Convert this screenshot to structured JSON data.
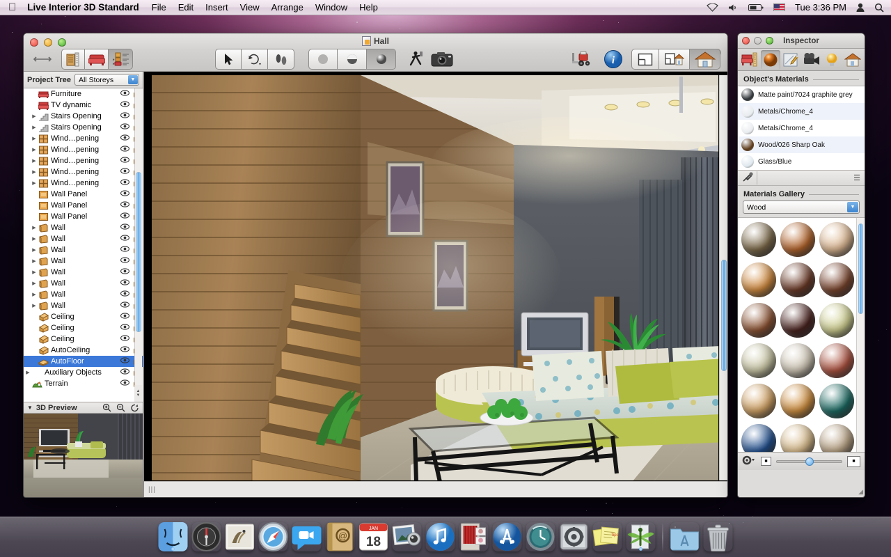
{
  "menubar": {
    "apple_icon": "apple-icon",
    "app_name": "Live Interior 3D Standard",
    "items": [
      "File",
      "Edit",
      "Insert",
      "View",
      "Arrange",
      "Window",
      "Help"
    ],
    "status": {
      "wifi_icon": "wifi-icon",
      "volume_icon": "volume-icon",
      "battery_icon": "battery-icon",
      "flag_icon": "us-flag-icon",
      "clock": "Tue 3:36 PM",
      "user_icon": "user-icon",
      "spotlight_icon": "search-icon"
    }
  },
  "window": {
    "title": "Hall",
    "doc_icon": "document-icon",
    "toolbar": {
      "resize_icon": "resize-horizontal-icon",
      "left_group": [
        {
          "name": "building-tool",
          "icon": "building-icon",
          "active": false
        },
        {
          "name": "furniture-tool",
          "icon": "armchair-icon",
          "active": false
        },
        {
          "name": "list-tool",
          "icon": "object-list-icon",
          "active": true
        }
      ],
      "select_group": [
        {
          "name": "arrow-select-tool",
          "icon": "arrow-cursor-icon",
          "active": false
        },
        {
          "name": "rotate-tool",
          "icon": "rotate-icon",
          "active": false
        },
        {
          "name": "walk-tool",
          "icon": "footprints-icon",
          "active": false
        }
      ],
      "render_group": [
        {
          "name": "flat-render",
          "icon": "flat-sphere-icon",
          "active": false
        },
        {
          "name": "shaded-render",
          "icon": "half-sphere-icon",
          "active": false
        },
        {
          "name": "realistic-render",
          "icon": "glossy-sphere-icon",
          "active": true
        }
      ],
      "walkthrough_icon": "walking-person-icon",
      "camera_icon": "camera-icon",
      "import_icon": "forklift-icon",
      "info_icon": "info-circle-icon",
      "view_group": [
        {
          "name": "plan-view",
          "icon": "floorplan-icon",
          "active": false
        },
        {
          "name": "plan-3d-view",
          "icon": "floorplan-3d-icon",
          "active": false
        },
        {
          "name": "3d-view",
          "icon": "house-icon",
          "active": true
        }
      ],
      "minimize_pill": "toolbar-toggle-pill"
    }
  },
  "project_tree": {
    "header_label": "Project Tree",
    "storey_filter": {
      "value": "All Storeys",
      "arrow_icon": "chevron-down-icon"
    },
    "col_eye_icon": "eye-icon",
    "col_lock_icon": "lock-open-icon",
    "rows": [
      {
        "label": "Furniture",
        "icon": "furniture-icon",
        "twisty": false,
        "indent": 1,
        "selected": false
      },
      {
        "label": "TV dynamic",
        "icon": "armchair-icon",
        "twisty": false,
        "indent": 1,
        "selected": false
      },
      {
        "label": "Stairs Opening",
        "icon": "stairs-icon",
        "twisty": true,
        "indent": 1,
        "selected": false
      },
      {
        "label": "Stairs Opening",
        "icon": "stairs-icon",
        "twisty": true,
        "indent": 1,
        "selected": false
      },
      {
        "label": "Wind…pening",
        "icon": "window-icon",
        "twisty": true,
        "indent": 1,
        "selected": false
      },
      {
        "label": "Wind…pening",
        "icon": "window-icon",
        "twisty": true,
        "indent": 1,
        "selected": false
      },
      {
        "label": "Wind…pening",
        "icon": "window-icon",
        "twisty": true,
        "indent": 1,
        "selected": false
      },
      {
        "label": "Wind…pening",
        "icon": "window-icon",
        "twisty": true,
        "indent": 1,
        "selected": false
      },
      {
        "label": "Wind…pening",
        "icon": "window-icon",
        "twisty": true,
        "indent": 1,
        "selected": false
      },
      {
        "label": "Wall Panel",
        "icon": "wall-panel-icon",
        "twisty": false,
        "indent": 1,
        "selected": false
      },
      {
        "label": "Wall Panel",
        "icon": "wall-panel-icon",
        "twisty": false,
        "indent": 1,
        "selected": false
      },
      {
        "label": "Wall Panel",
        "icon": "wall-panel-icon",
        "twisty": false,
        "indent": 1,
        "selected": false
      },
      {
        "label": "Wall",
        "icon": "wall-icon",
        "twisty": true,
        "indent": 1,
        "selected": false
      },
      {
        "label": "Wall",
        "icon": "wall-icon",
        "twisty": true,
        "indent": 1,
        "selected": false
      },
      {
        "label": "Wall",
        "icon": "wall-icon",
        "twisty": true,
        "indent": 1,
        "selected": false
      },
      {
        "label": "Wall",
        "icon": "wall-icon",
        "twisty": true,
        "indent": 1,
        "selected": false
      },
      {
        "label": "Wall",
        "icon": "wall-icon",
        "twisty": true,
        "indent": 1,
        "selected": false
      },
      {
        "label": "Wall",
        "icon": "wall-icon",
        "twisty": true,
        "indent": 1,
        "selected": false
      },
      {
        "label": "Wall",
        "icon": "wall-icon",
        "twisty": true,
        "indent": 1,
        "selected": false
      },
      {
        "label": "Wall",
        "icon": "wall-icon",
        "twisty": true,
        "indent": 1,
        "selected": false
      },
      {
        "label": "Ceiling",
        "icon": "ceiling-icon",
        "twisty": false,
        "indent": 1,
        "selected": false
      },
      {
        "label": "Ceiling",
        "icon": "ceiling-icon",
        "twisty": false,
        "indent": 1,
        "selected": false
      },
      {
        "label": "Ceiling",
        "icon": "ceiling-icon",
        "twisty": false,
        "indent": 1,
        "selected": false
      },
      {
        "label": "AutoCeiling",
        "icon": "ceiling-icon",
        "twisty": false,
        "indent": 1,
        "selected": false
      },
      {
        "label": "AutoFloor",
        "icon": "floor-icon",
        "twisty": false,
        "indent": 1,
        "selected": true
      },
      {
        "label": "Auxiliary Objects",
        "icon": "none",
        "twisty": true,
        "indent": 0,
        "selected": false
      },
      {
        "label": "Terrain",
        "icon": "terrain-icon",
        "twisty": false,
        "indent": 0,
        "selected": false
      }
    ]
  },
  "preview": {
    "label": "3D Preview",
    "disclosure_icon": "triangle-down-icon",
    "zoom_in_icon": "zoom-in-icon",
    "zoom_out_icon": "zoom-out-icon",
    "rotate_icon": "rotate-arrow-icon"
  },
  "inspector": {
    "title": "Inspector",
    "tabs": [
      {
        "name": "object-tab",
        "icon": "furniture-ruler-icon",
        "active": false
      },
      {
        "name": "materials-tab",
        "icon": "sphere-icon",
        "active": true
      },
      {
        "name": "edit-tab",
        "icon": "pencil-pad-icon",
        "active": false
      },
      {
        "name": "camera-tab",
        "icon": "video-camera-icon",
        "active": false
      },
      {
        "name": "light-tab",
        "icon": "lightbulb-icon",
        "active": false
      },
      {
        "name": "site-tab",
        "icon": "house-icon",
        "active": false
      }
    ],
    "object_materials": {
      "heading": "Object's Materials",
      "items": [
        {
          "name": "Matte paint/7024 graphite grey",
          "color": "#2f3438"
        },
        {
          "name": "Metals/Chrome_4",
          "color": "#e9ecef"
        },
        {
          "name": "Metals/Chrome_4",
          "color": "#e9ecef"
        },
        {
          "name": "Wood/026 Sharp Oak",
          "color": "#5d3a18"
        },
        {
          "name": "Glass/Blue",
          "color": "#dfe8ee"
        }
      ],
      "eyedropper_icon": "eyedropper-icon",
      "menu_icon": "hamburger-icon"
    },
    "materials_gallery": {
      "heading": "Materials Gallery",
      "category": {
        "value": "Wood",
        "arrow_icon": "chevron-down-icon"
      },
      "swatches": [
        "#7d6a4a",
        "#b4652c",
        "#ddb893",
        "#d08a3f",
        "#6b3a27",
        "#7a452e",
        "#8c5333",
        "#4a2420",
        "#cfcf92",
        "#c9c6a4",
        "#cfc6b5",
        "#ad5341",
        "#d1a264",
        "#cf8f40",
        "#1d6b64",
        "#22508f",
        "#d6b98a",
        "#b7a183"
      ]
    },
    "bottom_bar": {
      "gear_icon": "gear-dropdown-icon",
      "small_preview_icon": "small-thumbnail-icon",
      "large_preview_icon": "large-thumbnail-icon",
      "zoom_slider_value": 44
    },
    "resize_icon": "resize-grip-icon"
  },
  "dock": {
    "items": [
      {
        "name": "finder",
        "icon": "finder-icon",
        "running": true
      },
      {
        "name": "dashboard",
        "icon": "dashboard-icon",
        "running": false
      },
      {
        "name": "mail",
        "icon": "mail-icon",
        "running": false
      },
      {
        "name": "safari",
        "icon": "safari-icon",
        "running": false
      },
      {
        "name": "facetime",
        "icon": "facetime-icon",
        "running": false
      },
      {
        "name": "contacts",
        "icon": "contacts-icon",
        "running": false
      },
      {
        "name": "calendar",
        "icon": "calendar-icon",
        "running": false,
        "badge": "18"
      },
      {
        "name": "iphoto",
        "icon": "iphoto-icon",
        "running": false
      },
      {
        "name": "itunes",
        "icon": "itunes-icon",
        "running": false
      },
      {
        "name": "photo-booth",
        "icon": "photobooth-icon",
        "running": false
      },
      {
        "name": "app-store",
        "icon": "appstore-icon",
        "running": false
      },
      {
        "name": "time-machine",
        "icon": "timemachine-icon",
        "running": false
      },
      {
        "name": "system-prefs",
        "icon": "systemprefs-icon",
        "running": false
      },
      {
        "name": "stickies",
        "icon": "stickies-icon",
        "running": false
      },
      {
        "name": "live-interior-3d",
        "icon": "dragonfly-icon",
        "running": true
      }
    ],
    "right_items": [
      {
        "name": "applications-folder",
        "icon": "folder-icon"
      },
      {
        "name": "trash",
        "icon": "trash-icon"
      }
    ]
  }
}
